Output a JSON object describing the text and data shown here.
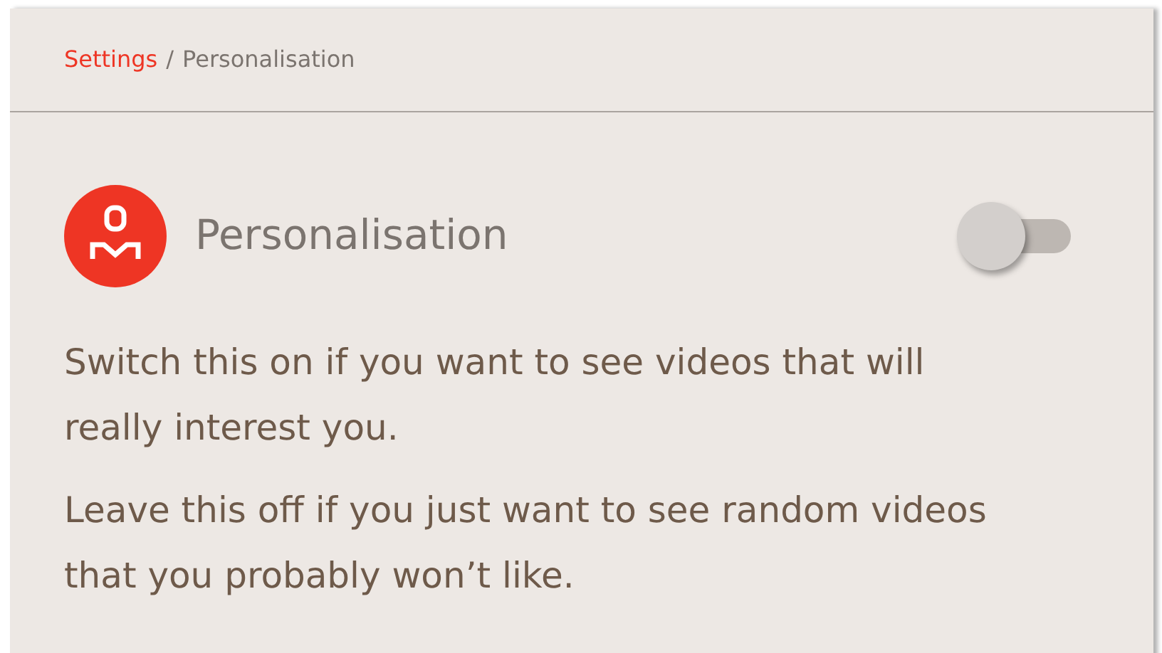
{
  "breadcrumb_separator": "/",
  "breadcrumb": [
    {
      "label": "Settings",
      "link": true
    },
    {
      "label": "Personalisation",
      "link": false
    }
  ],
  "setting": {
    "title": "Personalisation",
    "on": false
  },
  "paragraphs": [
    "Switch this on if you want to see videos that will really interest you.",
    "Leave this off if you just want to see random videos that you probably won’t like."
  ]
}
